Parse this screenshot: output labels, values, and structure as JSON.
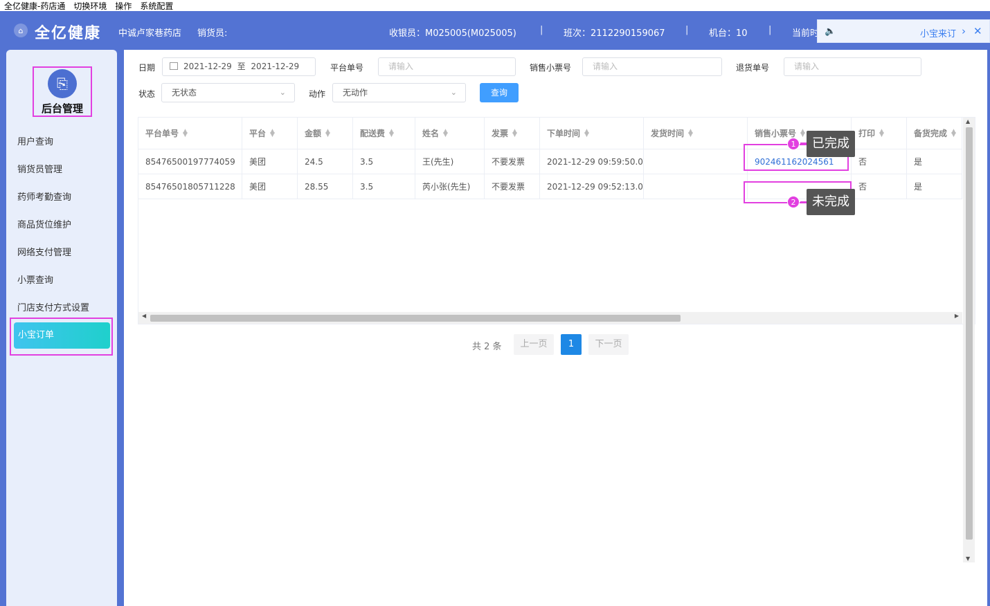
{
  "menubar": {
    "items": [
      "全亿健康-药店通",
      "切换环境",
      "操作",
      "系统配置"
    ]
  },
  "header": {
    "logo": "全亿健康",
    "store": "中诚卢家巷药店",
    "seller": "销货员:",
    "cashier": "收银员：M025005(M025005)",
    "shift": "班次：2112290159067",
    "machine": "机台：10",
    "current": "当前时",
    "separator": "|",
    "notify_text": "小宝来订"
  },
  "sidebar": {
    "brand": "后台管理",
    "items": [
      "用户查询",
      "销货员管理",
      "药师考勤查询",
      "商品货位维护",
      "网络支付管理",
      "小票查询",
      "门店支付方式设置"
    ],
    "active": "小宝订单"
  },
  "filters": {
    "date_label": "日期",
    "date_from": "2021-12-29",
    "date_to_sep": "至",
    "date_to": "2021-12-29",
    "platform_no_label": "平台单号",
    "sale_ticket_label": "销售小票号",
    "return_no_label": "退货单号",
    "placeholder": "请输入",
    "status_label": "状态",
    "status_value": "无状态",
    "action_label": "动作",
    "action_value": "无动作",
    "query_button": "查询"
  },
  "table": {
    "columns": [
      "平台单号",
      "平台",
      "金额",
      "配送费",
      "姓名",
      "发票",
      "下单时间",
      "发货时间",
      "销售小票号",
      "打印",
      "备货完成"
    ],
    "rows": [
      [
        "85476500197774059",
        "美团",
        "24.5",
        "3.5",
        "王(先生)",
        "不要发票",
        "2021-12-29 09:59:50.0",
        "",
        "902461162024561",
        "否",
        "是"
      ],
      [
        "85476501805711228",
        "美团",
        "28.55",
        "3.5",
        "芮小张(先生)",
        "不要发票",
        "2021-12-29 09:52:13.0",
        "",
        "",
        "否",
        "是"
      ]
    ]
  },
  "pagination": {
    "total": "共 2 条",
    "prev": "上一页",
    "current": "1",
    "next": "下一页"
  },
  "annotations": [
    {
      "num": "1",
      "text": "已完成"
    },
    {
      "num": "2",
      "text": "未完成"
    }
  ],
  "colors": {
    "header": "#5373d3",
    "highlight": "#e23fe0",
    "primary": "#409eff"
  }
}
